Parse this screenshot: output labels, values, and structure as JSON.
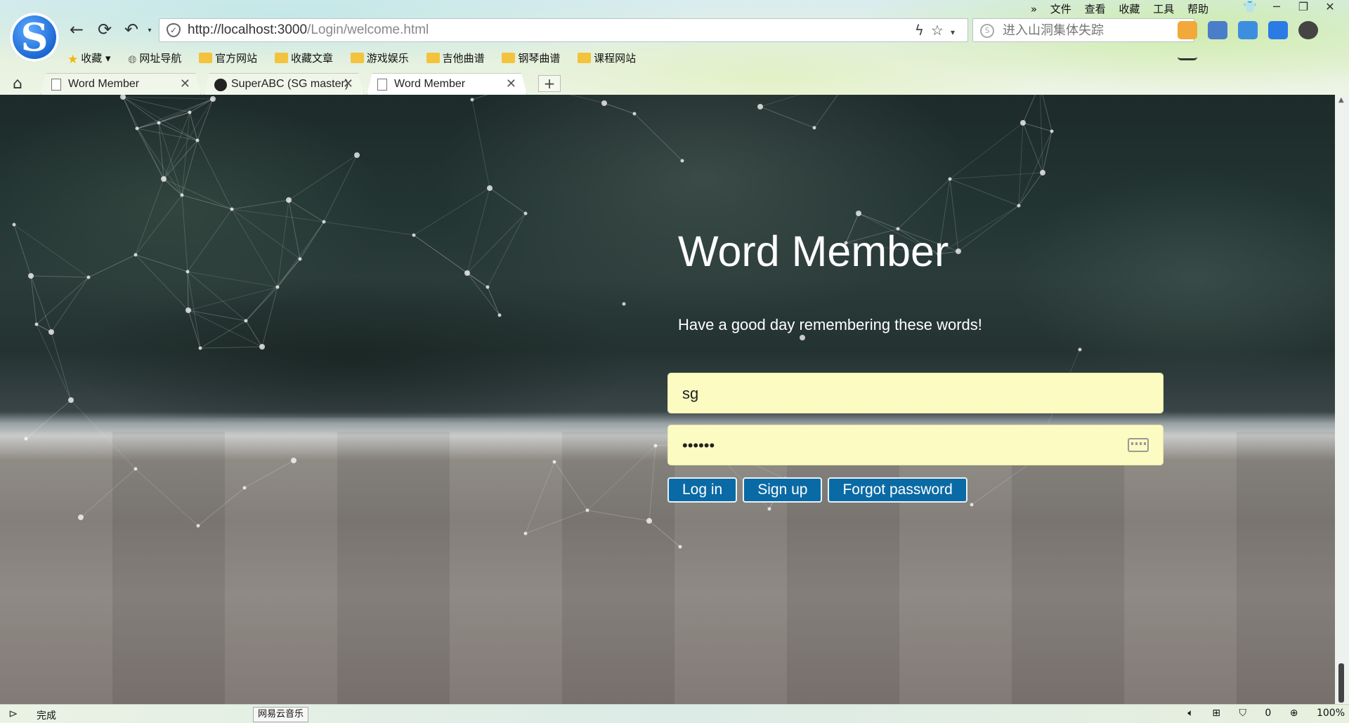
{
  "browser": {
    "address_url_host": "http://localhost:3000",
    "address_url_path": "/Login/welcome.html",
    "search_placeholder": "进入山洞集体失踪",
    "menu": [
      "文件",
      "查看",
      "收藏",
      "工具",
      "帮助"
    ],
    "bookmarks": [
      {
        "label": "收藏",
        "icon": "star-icon"
      },
      {
        "label": "网址导航",
        "icon": "globe-icon"
      },
      {
        "label": "官方网站",
        "icon": "folder-icon"
      },
      {
        "label": "收藏文章",
        "icon": "folder-icon"
      },
      {
        "label": "游戏娱乐",
        "icon": "folder-icon"
      },
      {
        "label": "吉他曲谱",
        "icon": "folder-icon"
      },
      {
        "label": "钢琴曲谱",
        "icon": "folder-icon"
      },
      {
        "label": "课程网站",
        "icon": "folder-icon"
      }
    ],
    "tabs": [
      {
        "label": "Word Member",
        "icon": "page-icon",
        "active": false
      },
      {
        "label": "SuperABC (SG master)",
        "icon": "github-icon",
        "active": false
      },
      {
        "label": "Word Member",
        "icon": "page-icon",
        "active": true
      }
    ],
    "new_tab_label": "+"
  },
  "page": {
    "title": "Word Member",
    "subtitle": "Have a good day remembering these words!",
    "username_value": "sg",
    "password_value": "••••••",
    "buttons": {
      "login": "Log in",
      "signup": "Sign up",
      "forgot": "Forgot password"
    },
    "colors": {
      "button_bg": "#0a6aa5",
      "field_bg": "#fbfbc2",
      "text": "#ffffff"
    }
  },
  "status": {
    "done_text": "完成",
    "music_label": "网易云音乐",
    "shield_count": "0",
    "zoom": "100%"
  }
}
